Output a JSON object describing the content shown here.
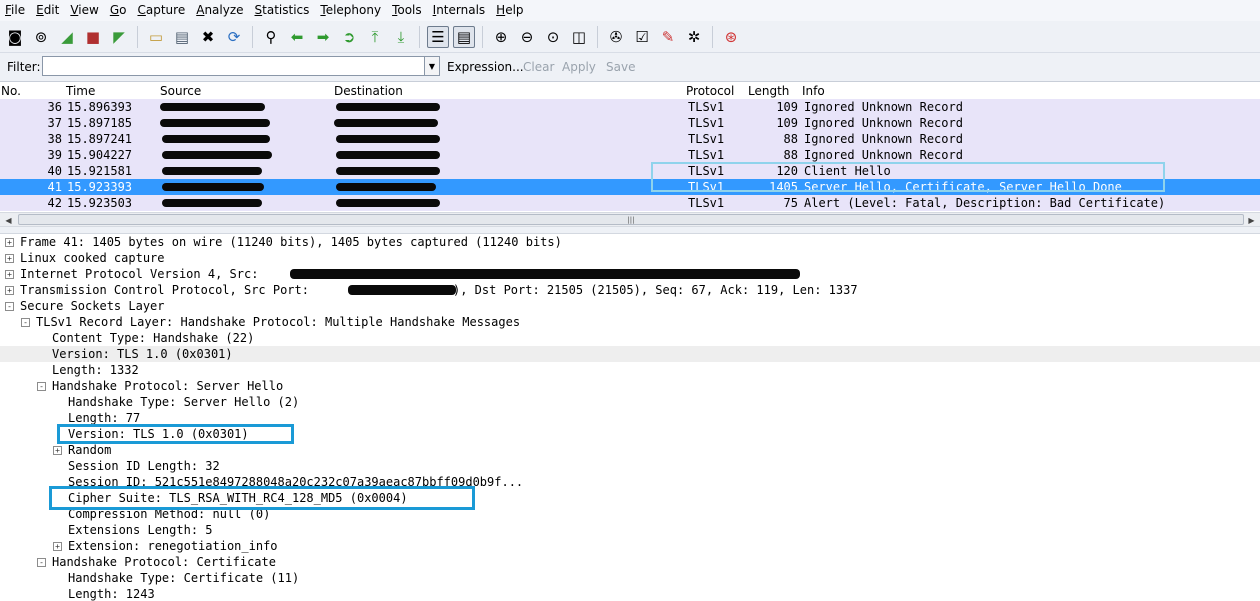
{
  "menu": [
    "File",
    "Edit",
    "View",
    "Go",
    "Capture",
    "Analyze",
    "Statistics",
    "Telephony",
    "Tools",
    "Internals",
    "Help"
  ],
  "toolbar_icons": [
    "interfaces-icon",
    "options-icon",
    "start-capture-icon",
    "stop-capture-icon",
    "restart-capture-icon",
    "open-file-icon",
    "save-file-icon",
    "close-file-icon",
    "reload-icon",
    "find-icon",
    "go-back-icon",
    "go-forward-icon",
    "go-to-packet-icon",
    "go-first-icon",
    "go-last-icon",
    "colorize-icon",
    "autoscroll-icon",
    "zoom-in-icon",
    "zoom-out-icon",
    "zoom-normal-icon",
    "resize-columns-icon",
    "capture-filters-icon",
    "display-filters-icon",
    "coloring-rules-icon",
    "preferences-icon",
    "help-icon"
  ],
  "filter": {
    "label": "Filter:",
    "value": "",
    "expression": "Expression...",
    "clear": "Clear",
    "apply": "Apply",
    "save": "Save"
  },
  "packet_list": {
    "columns": [
      "No.",
      "Time",
      "Source",
      "Destination",
      "Protocol",
      "Length",
      "Info"
    ],
    "rows": [
      {
        "no": "36",
        "time": "15.896393",
        "protocol": "TLSv1",
        "length": "109",
        "info": "Ignored Unknown Record",
        "selected": false
      },
      {
        "no": "37",
        "time": "15.897185",
        "protocol": "TLSv1",
        "length": "109",
        "info": "Ignored Unknown Record",
        "selected": false
      },
      {
        "no": "38",
        "time": "15.897241",
        "protocol": "TLSv1",
        "length": "88",
        "info": "Ignored Unknown Record",
        "selected": false
      },
      {
        "no": "39",
        "time": "15.904227",
        "protocol": "TLSv1",
        "length": "88",
        "info": "Ignored Unknown Record",
        "selected": false
      },
      {
        "no": "40",
        "time": "15.921581",
        "protocol": "TLSv1",
        "length": "120",
        "info": "Client Hello",
        "selected": false
      },
      {
        "no": "41",
        "time": "15.923393",
        "protocol": "TLSv1",
        "length": "1405",
        "info": "Server Hello, Certificate, Server Hello Done",
        "selected": true
      },
      {
        "no": "42",
        "time": "15.923503",
        "protocol": "TLSv1",
        "length": "75",
        "info": "Alert (Level: Fatal, Description: Bad Certificate)",
        "selected": false
      }
    ]
  },
  "details": [
    {
      "text": "Frame 41: 1405 bytes on wire (11240 bits), 1405 bytes captured (11240 bits)",
      "level": 0,
      "toggle": "+",
      "shade": false
    },
    {
      "text": "Linux cooked capture",
      "level": 0,
      "toggle": "+",
      "shade": false
    },
    {
      "text": "Internet Protocol Version 4, Src: ",
      "level": 0,
      "toggle": "+",
      "shade": false
    },
    {
      "text": "Transmission Control Protocol, Src Port: ",
      "level": 0,
      "toggle": "+",
      "shade": false
    },
    {
      "text": "Secure Sockets Layer",
      "level": 0,
      "toggle": "-",
      "shade": false
    },
    {
      "text": "TLSv1 Record Layer: Handshake Protocol: Multiple Handshake Messages",
      "level": 1,
      "toggle": "-",
      "shade": false
    },
    {
      "text": "Content Type: Handshake (22)",
      "level": 2,
      "toggle": "",
      "shade": false
    },
    {
      "text": "Version: TLS 1.0 (0x0301)",
      "level": 2,
      "toggle": "",
      "shade": true
    },
    {
      "text": "Length: 1332",
      "level": 2,
      "toggle": "",
      "shade": false
    },
    {
      "text": "Handshake Protocol: Server Hello",
      "level": 2,
      "toggle": "-",
      "shade": false
    },
    {
      "text": "Handshake Type: Server Hello (2)",
      "level": 3,
      "toggle": "",
      "shade": false
    },
    {
      "text": "Length: 77",
      "level": 3,
      "toggle": "",
      "shade": false
    },
    {
      "text": "Version: TLS 1.0 (0x0301)",
      "level": 3,
      "toggle": "",
      "shade": false
    },
    {
      "text": "Random",
      "level": 3,
      "toggle": "+",
      "shade": false
    },
    {
      "text": "Session ID Length: 32",
      "level": 3,
      "toggle": "",
      "shade": false
    },
    {
      "text": "Session ID: 521c551e8497288048a20c232c07a39aeac87bbff09d0b9f...",
      "level": 3,
      "toggle": "",
      "shade": false
    },
    {
      "text": "Cipher Suite: TLS_RSA_WITH_RC4_128_MD5 (0x0004)",
      "level": 3,
      "toggle": "",
      "shade": false
    },
    {
      "text": "Compression Method: null (0)",
      "level": 3,
      "toggle": "",
      "shade": false
    },
    {
      "text": "Extensions Length: 5",
      "level": 3,
      "toggle": "",
      "shade": false
    },
    {
      "text": "Extension: renegotiation_info",
      "level": 3,
      "toggle": "+",
      "shade": false
    },
    {
      "text": "Handshake Protocol: Certificate",
      "level": 2,
      "toggle": "-",
      "shade": false
    },
    {
      "text": "Handshake Type: Certificate (11)",
      "level": 3,
      "toggle": "",
      "shade": false
    },
    {
      "text": "Length: 1243",
      "level": 3,
      "toggle": "",
      "shade": false
    }
  ],
  "tcp_tail": "), Dst Port: 21505 (21505), Seq: 67, Ack: 119, Len: 1337",
  "colors": {
    "selected_row": "#3399ff",
    "row_bg": "#e8e4f9",
    "highlight_box": "#1a9ad6",
    "highlight_thin": "#8fd3ec"
  }
}
